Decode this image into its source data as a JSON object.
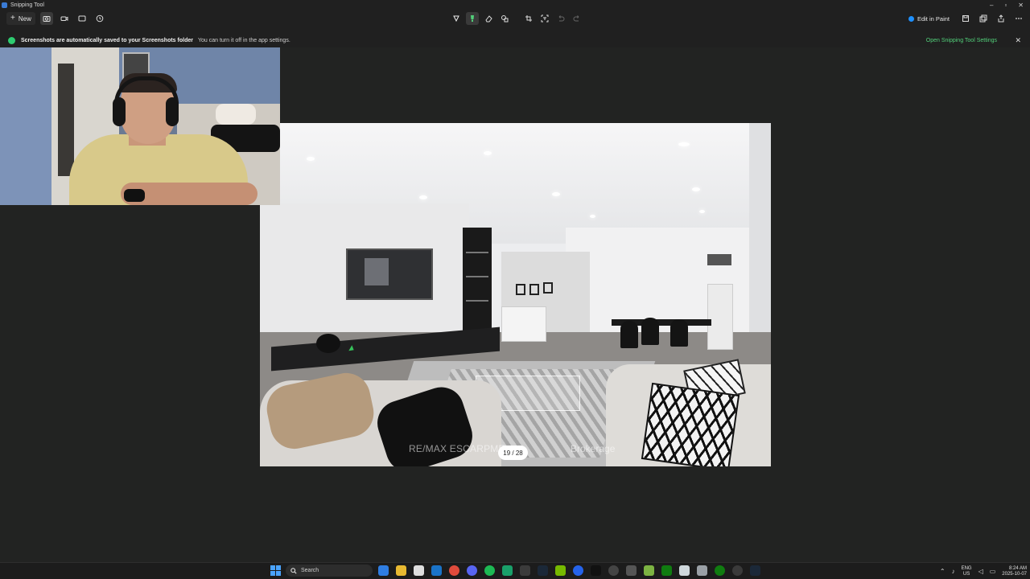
{
  "window": {
    "title": "Snipping Tool",
    "controls": [
      "–",
      "▫",
      "✕"
    ]
  },
  "toolbar": {
    "new_label": "New",
    "edit_in_paint_label": "Edit in Paint"
  },
  "notification": {
    "bold_text": "Screenshots are automatically saved to your Screenshots folder",
    "sub_text": "You can turn it off in the app settings.",
    "link_text": "Open Snipping Tool Settings",
    "close_glyph": "✕"
  },
  "photo": {
    "watermark_left": "RE/MAX ESCARPME",
    "watermark_right": "Brokerage",
    "page_indicator": "19 / 28"
  },
  "taskbar": {
    "search_placeholder": "Search",
    "language_top": "ENG",
    "language_bottom": "US",
    "time": "8:24 AM",
    "date": "2025-10-07"
  },
  "colors": {
    "background": "#202020",
    "accent_green": "#52d07a",
    "status_green": "#2ecc71"
  }
}
